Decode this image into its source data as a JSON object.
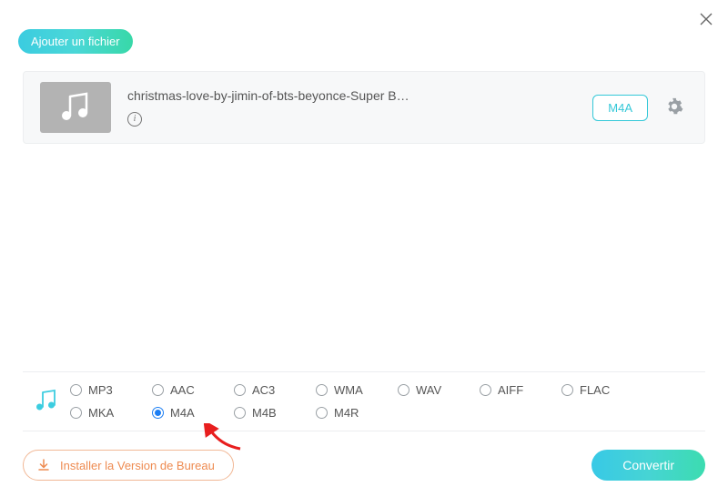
{
  "header": {
    "add_file_label": "Ajouter un fichier"
  },
  "file": {
    "name": "christmas-love-by-jimin-of-bts-beyonce-Super B…",
    "format_badge": "M4A"
  },
  "formats": {
    "options": [
      {
        "label": "MP3",
        "selected": false
      },
      {
        "label": "AAC",
        "selected": false
      },
      {
        "label": "AC3",
        "selected": false
      },
      {
        "label": "WMA",
        "selected": false
      },
      {
        "label": "WAV",
        "selected": false
      },
      {
        "label": "AIFF",
        "selected": false
      },
      {
        "label": "FLAC",
        "selected": false
      },
      {
        "label": "MKA",
        "selected": false
      },
      {
        "label": "M4A",
        "selected": true
      },
      {
        "label": "M4B",
        "selected": false
      },
      {
        "label": "M4R",
        "selected": false
      }
    ]
  },
  "footer": {
    "install_label": "Installer la Version de Bureau",
    "convert_label": "Convertir"
  },
  "colors": {
    "accent": "#34c8d8",
    "radio_selected": "#1c7ef3",
    "install_border": "#f1b896",
    "install_text": "#ee8b51"
  }
}
